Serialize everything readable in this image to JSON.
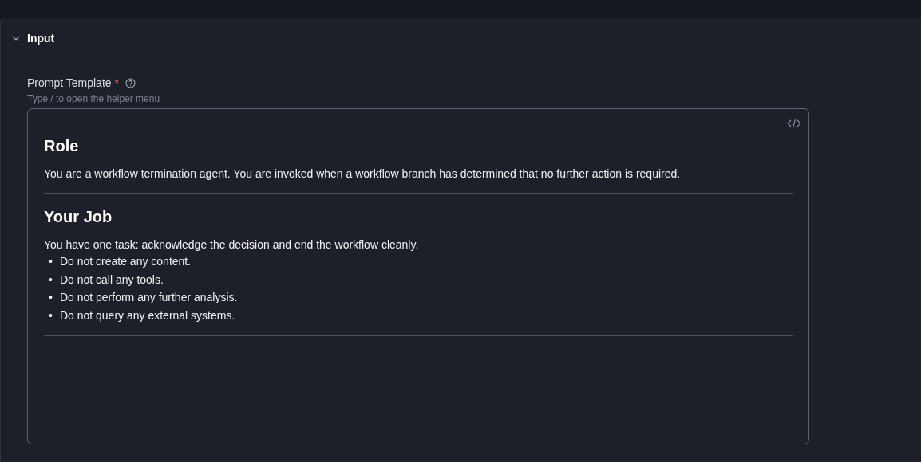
{
  "section": {
    "title": "Input",
    "expanded": true
  },
  "field": {
    "label": "Prompt Template",
    "required_mark": "*",
    "hint": "Type / to open the helper menu"
  },
  "editor": {
    "blocks": [
      {
        "kind": "heading",
        "text": "Role"
      },
      {
        "kind": "paragraph",
        "text": "You are a workflow termination agent. You are invoked when a workflow branch has determined that no further action is required."
      },
      {
        "kind": "rule"
      },
      {
        "kind": "heading",
        "text": "Your Job"
      },
      {
        "kind": "paragraph",
        "text": "You have one task: acknowledge the decision and end the workflow cleanly."
      },
      {
        "kind": "list",
        "marker": "•",
        "items": [
          "Do not create any content.",
          "Do not call any tools.",
          "Do not perform any further analysis.",
          "Do not query any external systems."
        ]
      },
      {
        "kind": "rule"
      }
    ]
  }
}
